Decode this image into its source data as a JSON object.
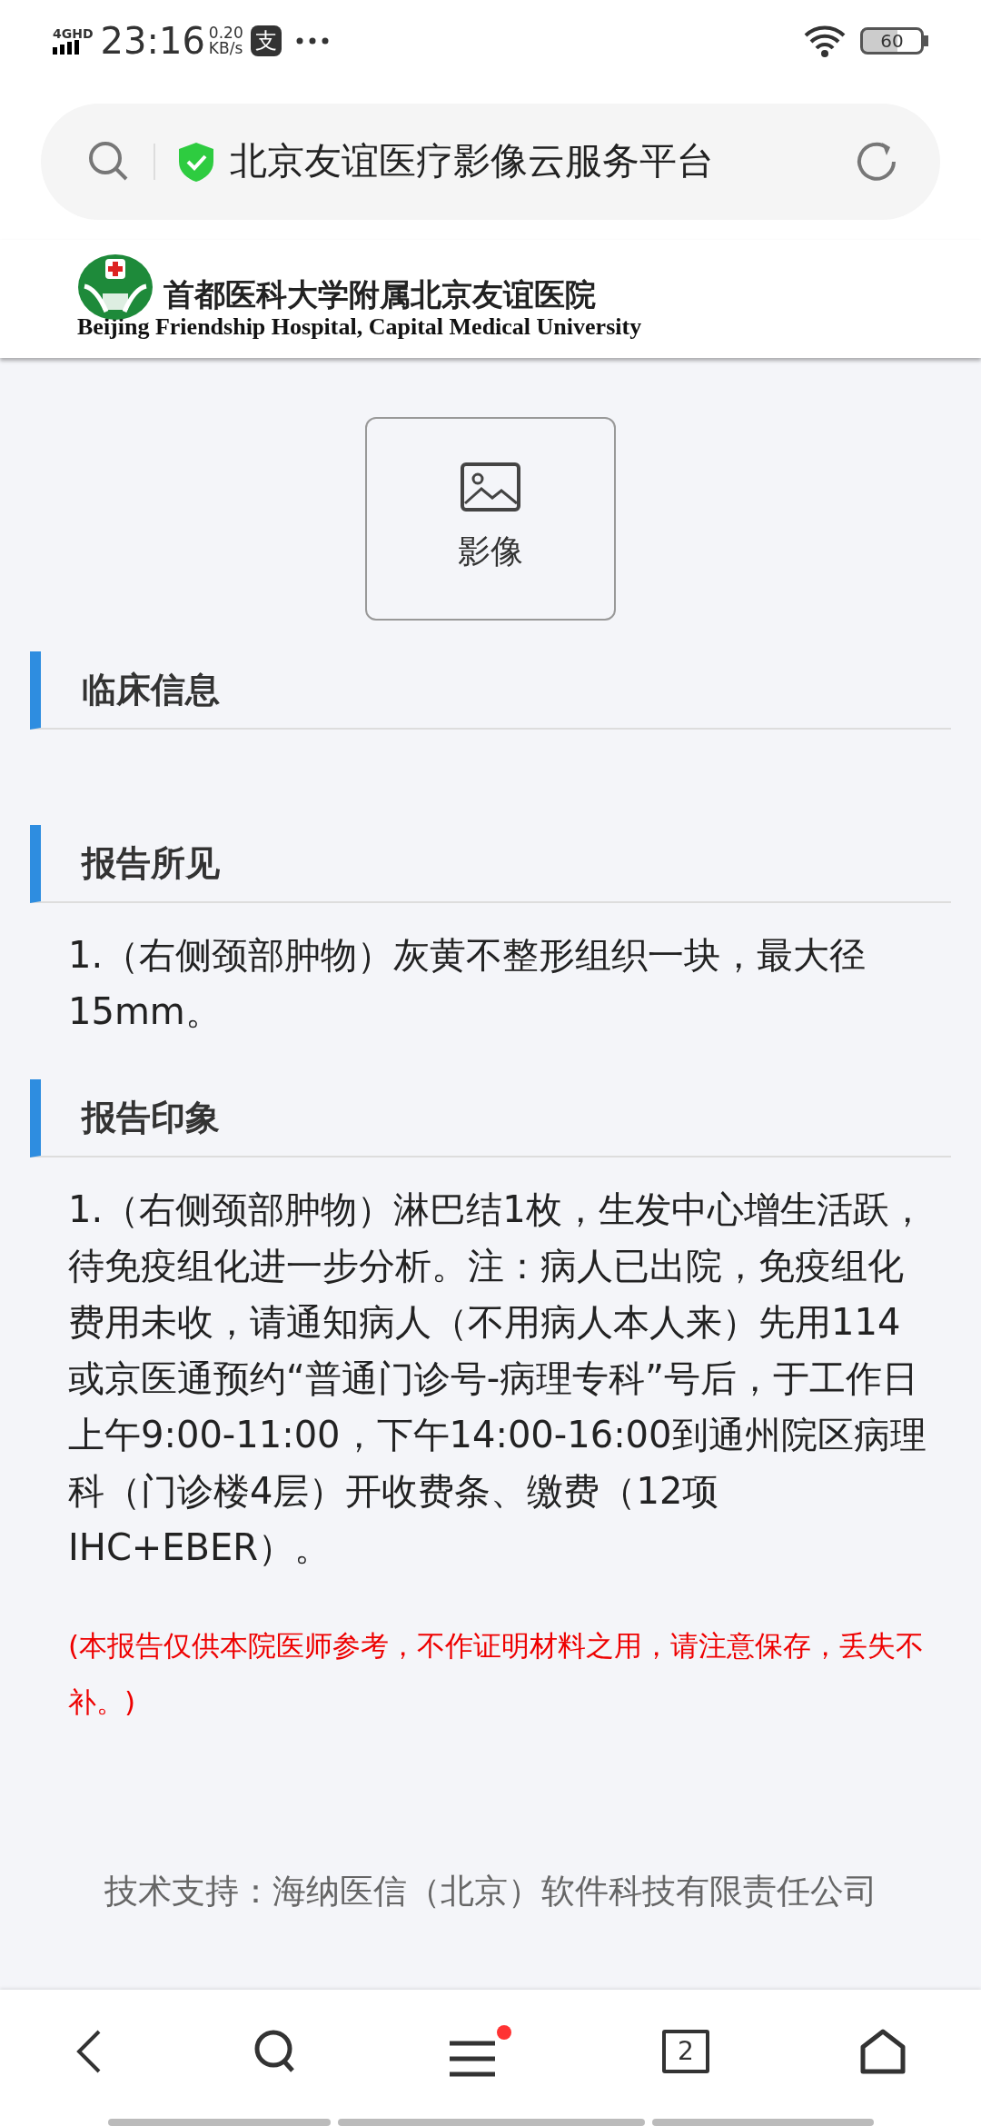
{
  "status_bar": {
    "network": "4G",
    "network_extra": "HD",
    "time": "23:16",
    "speed": "0.20",
    "speed_unit": "KB/s",
    "app_glyph": "支",
    "battery": "60"
  },
  "address_bar": {
    "title": "北京友谊医疗影像云服务平台",
    "secure": true
  },
  "header": {
    "name_cn": "首都医科大学附属北京友谊医院",
    "name_en": "Beijing Friendship Hospital, Capital Medical University"
  },
  "image_button": {
    "label": "影像"
  },
  "sections": [
    {
      "title": "临床信息"
    },
    {
      "title": "报告所见",
      "body": "1.（右侧颈部肿物）灰黄不整形组织一块，最大径15mm。"
    },
    {
      "title": "报告印象",
      "body": "1.（右侧颈部肿物）淋巴结1枚，生发中心增生活跃，待免疫组化进一步分析。注：病人已出院，免疫组化费用未收，请通知病人（不用病人本人来）先用114或京医通预约“普通门诊号-病理专科”号后，于工作日上午9:00-11:00，下午14:00-16:00到通州院区病理科（门诊楼4层）开收费条、缴费（12项IHC+EBER）。"
    }
  ],
  "note": "(本报告仅供本院医师参考，不作证明材料之用，请注意保存，丢失不补。)",
  "footer": "技术支持：海纳医信（北京）软件科技有限责任公司",
  "bottom_nav": {
    "menu_has_update": true,
    "tab_count": "2"
  }
}
